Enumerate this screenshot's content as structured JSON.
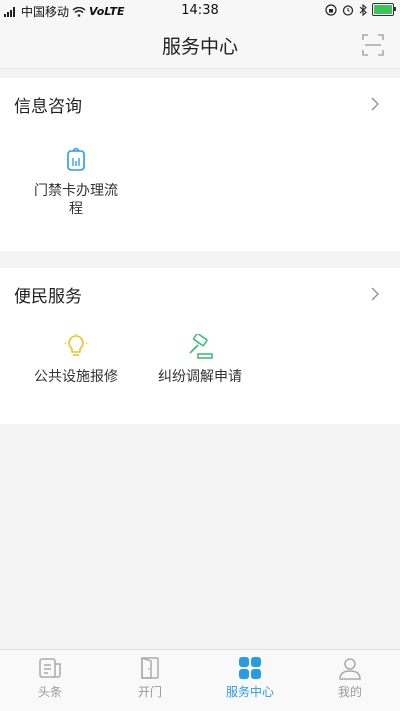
{
  "status_bar": {
    "carrier": "中国移动",
    "network": "VoLTE",
    "time": "14:38"
  },
  "nav": {
    "title": "服务中心",
    "scan_icon": "scan-icon"
  },
  "sections": [
    {
      "title": "信息咨询",
      "items": [
        {
          "label": "门禁卡办理流程",
          "icon": "access-card-icon",
          "color": "#2a9ae6"
        }
      ]
    },
    {
      "title": "便民服务",
      "items": [
        {
          "label": "公共设施报修",
          "icon": "lightbulb-icon",
          "color": "#e8c51e"
        },
        {
          "label": "纠纷调解申请",
          "icon": "gavel-icon",
          "color": "#3cbf7a"
        }
      ]
    }
  ],
  "tabs": [
    {
      "label": "头条",
      "icon": "news-icon",
      "active": false
    },
    {
      "label": "开门",
      "icon": "door-icon",
      "active": false
    },
    {
      "label": "服务中心",
      "icon": "grid-icon",
      "active": true
    },
    {
      "label": "我的",
      "icon": "user-icon",
      "active": false
    }
  ],
  "colors": {
    "accent": "#2a9ae6",
    "inactive": "#999999",
    "background": "#f4f4f4"
  }
}
